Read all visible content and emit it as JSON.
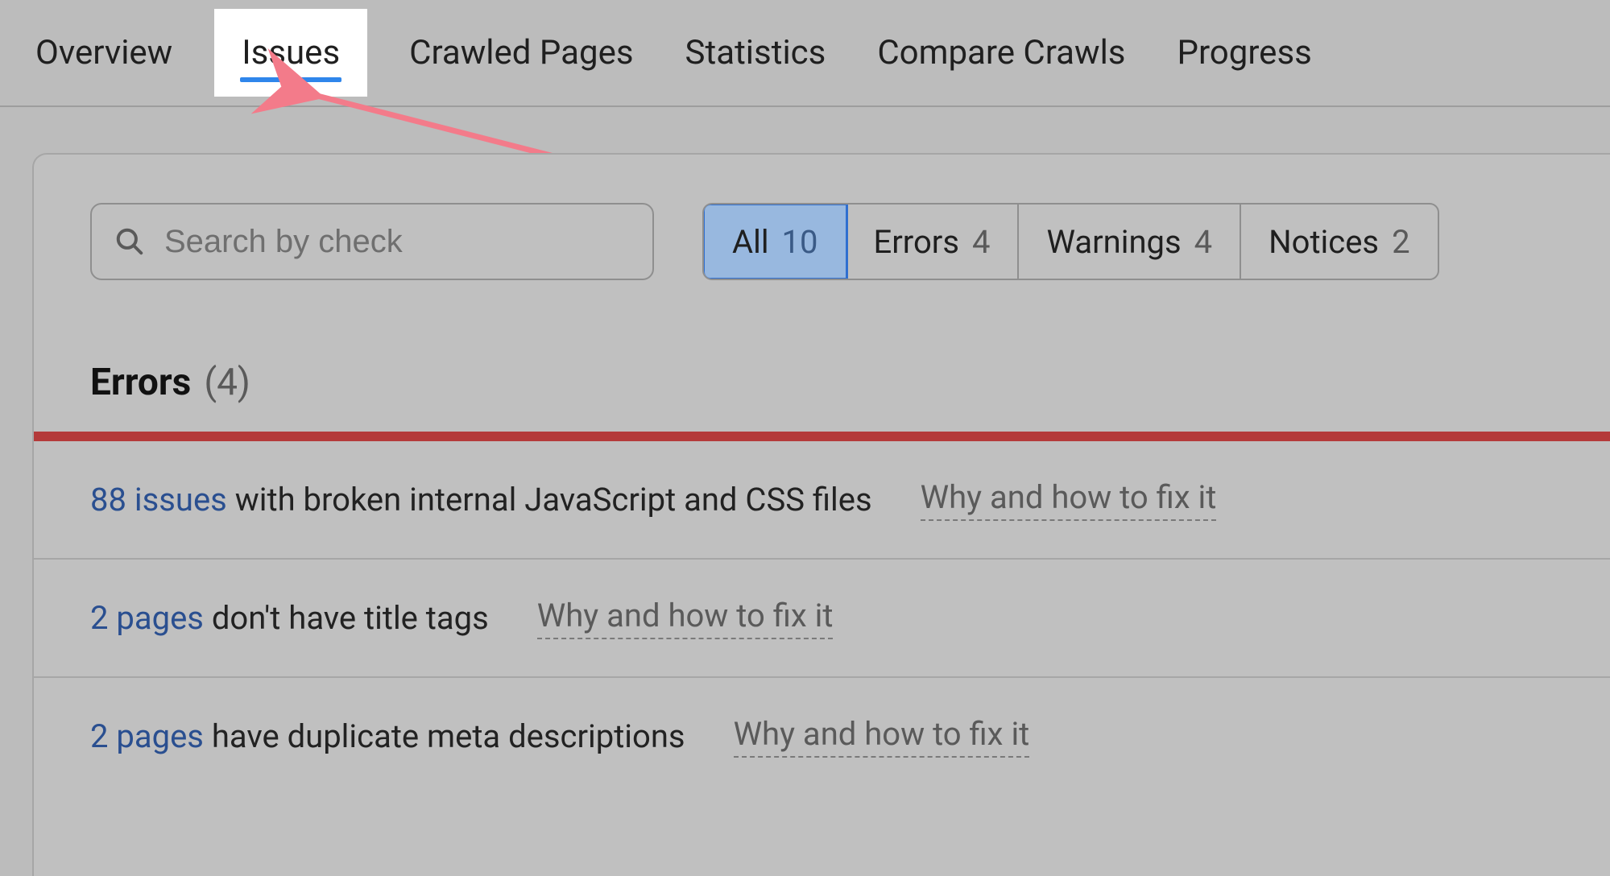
{
  "tabs": {
    "items": [
      {
        "label": "Overview"
      },
      {
        "label": "Issues"
      },
      {
        "label": "Crawled Pages"
      },
      {
        "label": "Statistics"
      },
      {
        "label": "Compare Crawls"
      },
      {
        "label": "Progress"
      }
    ],
    "active_index": 1
  },
  "search": {
    "placeholder": "Search by check",
    "value": ""
  },
  "filters": {
    "items": [
      {
        "label": "All",
        "count": "10",
        "active": true
      },
      {
        "label": "Errors",
        "count": "4",
        "active": false
      },
      {
        "label": "Warnings",
        "count": "4",
        "active": false
      },
      {
        "label": "Notices",
        "count": "2",
        "active": false
      }
    ]
  },
  "section": {
    "title": "Errors",
    "count_display": "(4)"
  },
  "issues": [
    {
      "lead": "88 issues",
      "rest": " with broken internal JavaScript and CSS files",
      "help": "Why and how to fix it"
    },
    {
      "lead": "2 pages",
      "rest": " don't have title tags",
      "help": "Why and how to fix it"
    },
    {
      "lead": "2 pages",
      "rest": " have duplicate meta descriptions",
      "help": "Why and how to fix it"
    }
  ],
  "colors": {
    "accent_blue": "#2f86eb",
    "error_red": "#b43a3a",
    "arrow_pink": "#f37b8a"
  }
}
